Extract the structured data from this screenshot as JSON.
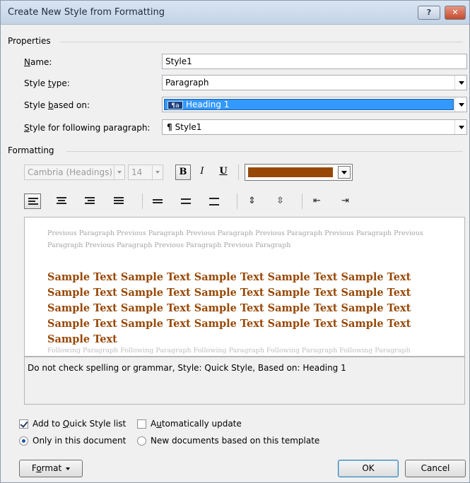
{
  "window": {
    "title": "Create New Style from Formatting",
    "help_label": "?",
    "close_label": "✕"
  },
  "properties": {
    "group_label": "Properties",
    "name_label": "Name:",
    "name_value": "Style1",
    "style_type_label": "Style type:",
    "style_type_value": "Paragraph",
    "based_on_label": "Style based on:",
    "based_on_value": "Heading 1",
    "based_on_icon_text": "¶a",
    "following_label": "Style for following paragraph:",
    "following_value": "Style1",
    "following_icon": "¶"
  },
  "formatting": {
    "group_label": "Formatting",
    "font_value": "Cambria (Headings)",
    "size_value": "14",
    "bold_label": "B",
    "italic_label": "I",
    "underline_label": "U",
    "font_color": "#984806"
  },
  "preview": {
    "previous_paragraph": "Previous Paragraph Previous Paragraph Previous Paragraph Previous Paragraph Previous Paragraph Previous Paragraph Previous Paragraph Previous Paragraph Previous Paragraph",
    "sample_text": "Sample Text Sample Text Sample Text Sample Text Sample Text Sample Text Sample Text Sample Text Sample Text Sample Text Sample Text Sample Text Sample Text Sample Text Sample Text Sample Text Sample Text Sample Text Sample Text Sample Text Sample Text",
    "following_paragraph": "Following Paragraph Following Paragraph Following Paragraph Following Paragraph Following Paragraph"
  },
  "description": "Do not check spelling or grammar, Style: Quick Style, Based on: Heading 1",
  "options": {
    "add_quick_style_label": "Add to Quick Style list",
    "add_quick_style_checked": true,
    "auto_update_label": "Automatically update",
    "auto_update_checked": false,
    "only_this_doc_label": "Only in this document",
    "new_docs_label": "New documents based on this template",
    "selected_scope": "Only in this document"
  },
  "buttons": {
    "format_label": "Format",
    "ok_label": "OK",
    "cancel_label": "Cancel"
  }
}
